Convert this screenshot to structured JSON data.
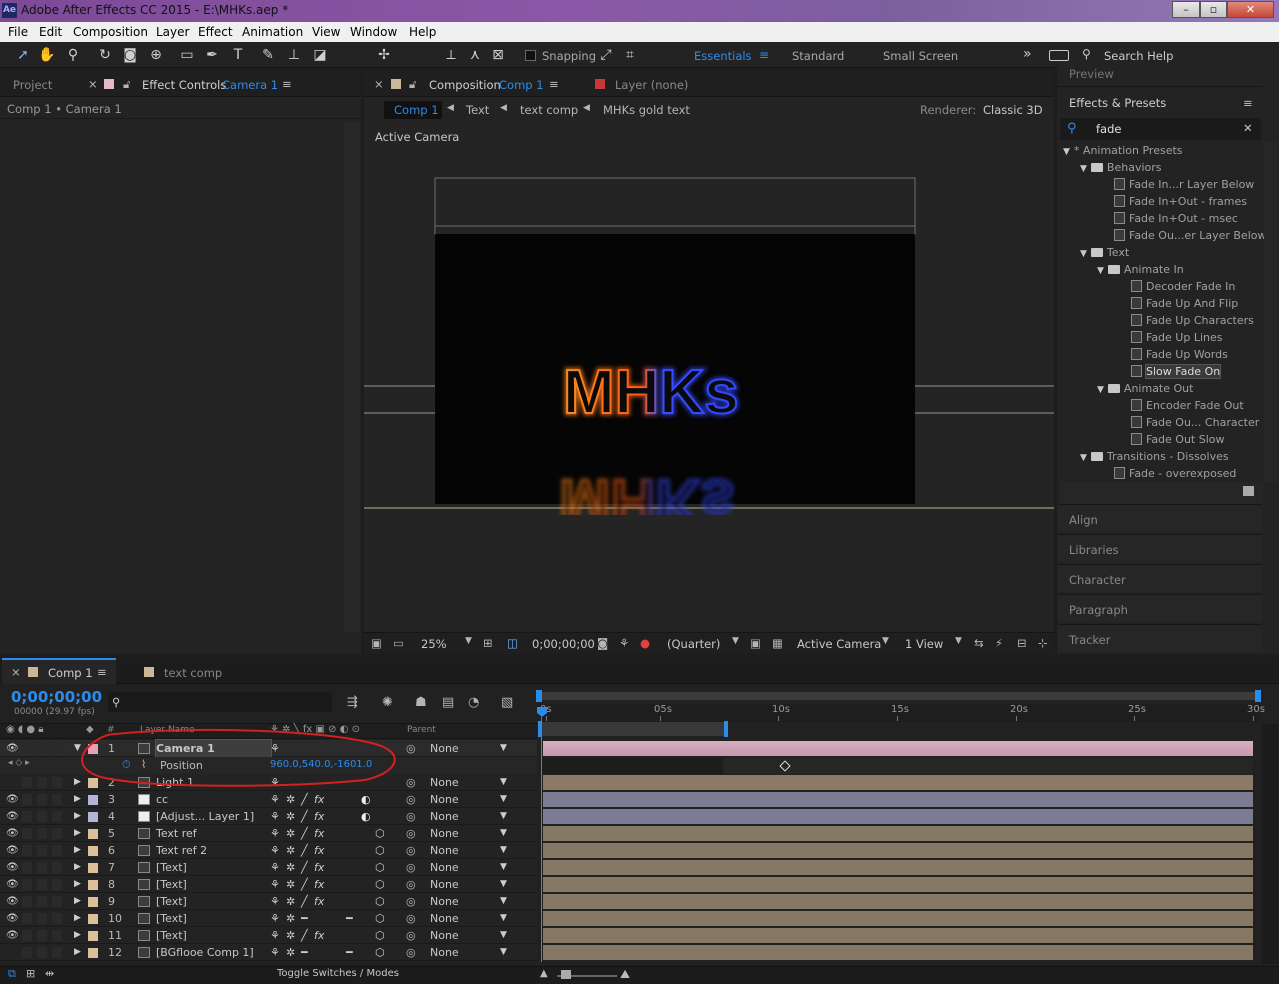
{
  "window": {
    "title": "Adobe After Effects CC 2015 - E:\\MHKs.aep *",
    "app_icon": "Ae"
  },
  "menu": [
    "File",
    "Edit",
    "Composition",
    "Layer",
    "Effect",
    "Animation",
    "View",
    "Window",
    "Help"
  ],
  "toolbar": {
    "snapping_label": "Snapping",
    "workspaces": [
      "Essentials",
      "Standard",
      "Small Screen"
    ],
    "search_help": "Search Help"
  },
  "project_panel": {
    "tab_project": "Project",
    "tab_effect_controls": "Effect Controls",
    "effect_controls_target": "Camera 1",
    "breadcrumb": "Comp 1 • Camera 1"
  },
  "composition_panel": {
    "tab_label": "Composition",
    "comp_name": "Comp 1",
    "layer_tab": "Layer (none)",
    "breadcrumbs": [
      "Comp 1",
      "Text",
      "text comp",
      "MHKs gold text"
    ],
    "renderer_label": "Renderer:",
    "renderer_value": "Classic 3D",
    "view_label": "Active Camera",
    "artwork_text": "MHKs",
    "footer": {
      "zoom": "25%",
      "timecode": "0;00;00;00",
      "resolution": "(Quarter)",
      "camera": "Active Camera",
      "views": "1 View"
    }
  },
  "effects_presets": {
    "preview_label": "Preview",
    "title": "Effects & Presets",
    "search_value": "fade",
    "tree": [
      {
        "label": "* Animation Presets",
        "type": "folder",
        "level": 0
      },
      {
        "label": "Behaviors",
        "type": "folder",
        "level": 1
      },
      {
        "label": "Fade In...r Layer Below",
        "type": "preset",
        "level": 2
      },
      {
        "label": "Fade In+Out - frames",
        "type": "preset",
        "level": 2
      },
      {
        "label": "Fade In+Out - msec",
        "type": "preset",
        "level": 2
      },
      {
        "label": "Fade Ou...er Layer Below",
        "type": "preset",
        "level": 2
      },
      {
        "label": "Text",
        "type": "folder",
        "level": 1
      },
      {
        "label": "Animate In",
        "type": "folder",
        "level": 2
      },
      {
        "label": "Decoder Fade In",
        "type": "preset",
        "level": 3
      },
      {
        "label": "Fade Up And Flip",
        "type": "preset",
        "level": 3
      },
      {
        "label": "Fade Up Characters",
        "type": "preset",
        "level": 3
      },
      {
        "label": "Fade Up Lines",
        "type": "preset",
        "level": 3
      },
      {
        "label": "Fade Up Words",
        "type": "preset",
        "level": 3
      },
      {
        "label": "Slow Fade On",
        "type": "preset",
        "level": 3,
        "selected": true
      },
      {
        "label": "Animate Out",
        "type": "folder",
        "level": 2
      },
      {
        "label": "Encoder Fade Out",
        "type": "preset",
        "level": 3
      },
      {
        "label": "Fade Ou... Character",
        "type": "preset",
        "level": 3
      },
      {
        "label": "Fade Out Slow",
        "type": "preset",
        "level": 3
      },
      {
        "label": "Transitions - Dissolves",
        "type": "folder",
        "level": 1
      },
      {
        "label": "Fade - overexposed",
        "type": "preset",
        "level": 2
      }
    ],
    "collapsed_panels": [
      "Align",
      "Libraries",
      "Character",
      "Paragraph",
      "Tracker"
    ]
  },
  "timeline": {
    "tabs": [
      "Comp 1",
      "text comp"
    ],
    "timecode": "0;00;00;00",
    "frame_info": "00000 (29.97 fps)",
    "columns": {
      "layer_name": "Layer Name",
      "parent": "Parent",
      "num": "#"
    },
    "ruler": [
      "0s",
      "05s",
      "10s",
      "15s",
      "20s",
      "25s",
      "30s"
    ],
    "position_property": {
      "label": "Position",
      "value": "960.0,540.0,-1601.0"
    },
    "layers": [
      {
        "num": "1",
        "name": "Camera 1",
        "color": "#e8a0b8",
        "bar": "#c9a0b4",
        "parent": "None",
        "vis": true
      },
      {
        "num": "2",
        "name": "Light 1",
        "color": "#dcc09a",
        "bar": "#8a7a66",
        "parent": "None",
        "vis": false
      },
      {
        "num": "3",
        "name": "cc",
        "color": "#b4b4d8",
        "bar": "#7b7c92",
        "parent": "None",
        "vis": true
      },
      {
        "num": "4",
        "name": "[Adjust... Layer 1]",
        "color": "#b4b4d8",
        "bar": "#7b7c92",
        "parent": "None",
        "vis": true
      },
      {
        "num": "5",
        "name": "Text ref",
        "color": "#dcc09a",
        "bar": "#857966",
        "parent": "None",
        "vis": true
      },
      {
        "num": "6",
        "name": "Text ref 2",
        "color": "#dcc09a",
        "bar": "#857966",
        "parent": "None",
        "vis": true
      },
      {
        "num": "7",
        "name": "[Text]",
        "color": "#dcc09a",
        "bar": "#857966",
        "parent": "None",
        "vis": true
      },
      {
        "num": "8",
        "name": "[Text]",
        "color": "#dcc09a",
        "bar": "#857966",
        "parent": "None",
        "vis": true
      },
      {
        "num": "9",
        "name": "[Text]",
        "color": "#dcc09a",
        "bar": "#857966",
        "parent": "None",
        "vis": true
      },
      {
        "num": "10",
        "name": "[Text]",
        "color": "#dcc09a",
        "bar": "#857966",
        "parent": "None",
        "vis": true
      },
      {
        "num": "11",
        "name": "[Text]",
        "color": "#dcc09a",
        "bar": "#857966",
        "parent": "None",
        "vis": true
      },
      {
        "num": "12",
        "name": "[BGflooe Comp 1]",
        "color": "#dcc09a",
        "bar": "#857966",
        "parent": "None",
        "vis": false
      }
    ],
    "footer_label": "Toggle Switches / Modes"
  },
  "colors": {
    "accent": "#2d8ceb",
    "annotation": "#d42020",
    "panel_bg": "#232323"
  }
}
